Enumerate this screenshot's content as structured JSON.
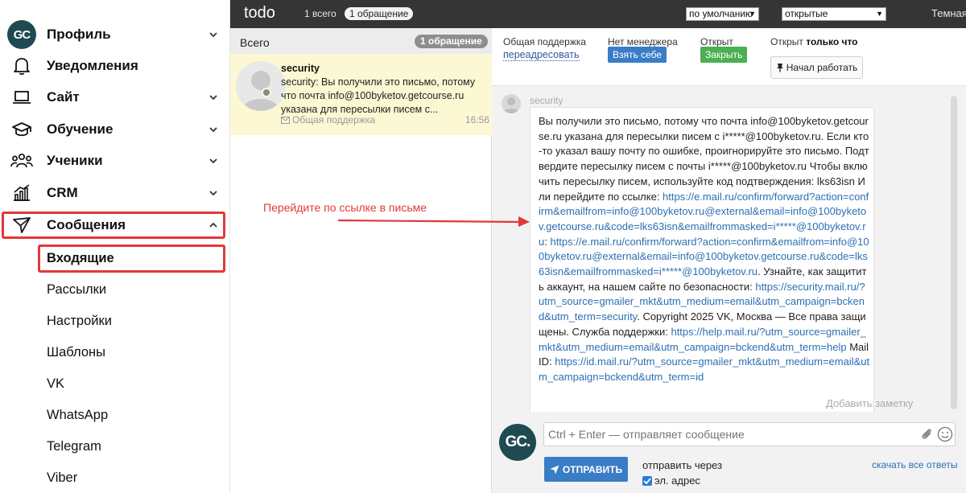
{
  "sidebar": {
    "logo": "GC",
    "items": [
      {
        "label": "Профиль",
        "icon": "gc-logo-icon",
        "chevron": "down"
      },
      {
        "label": "Уведомления",
        "icon": "bell-icon",
        "chevron": null
      },
      {
        "label": "Сайт",
        "icon": "laptop-icon",
        "chevron": "down"
      },
      {
        "label": "Обучение",
        "icon": "graduation-cap-icon",
        "chevron": "down"
      },
      {
        "label": "Ученики",
        "icon": "users-icon",
        "chevron": "down"
      },
      {
        "label": "CRM",
        "icon": "chart-icon",
        "chevron": "down"
      },
      {
        "label": "Сообщения",
        "icon": "send-icon",
        "chevron": "up"
      }
    ],
    "submenu": [
      "Входящие",
      "Рассылки",
      "Настройки",
      "Шаблоны",
      "VK",
      "WhatsApp",
      "Telegram",
      "Viber"
    ]
  },
  "topbar": {
    "title": "todo",
    "count": "1 всего",
    "pill": "1 обращение",
    "sort_select": "по умолчанию",
    "status_select": "открытые",
    "theme": "Темная"
  },
  "list": {
    "header_label": "Всего",
    "header_pill": "1 обращение",
    "ticket": {
      "name": "security",
      "preview": "security: Вы получили это письмо, потому что почта info@100byketov.getcourse.ru указана для пересылки писем с...",
      "source": "Общая поддержка",
      "time": "16:56"
    }
  },
  "conversation": {
    "header": {
      "support_label": "Общая поддержка",
      "reassign_link": "переадресовать",
      "no_manager_label": "Нет менеджера",
      "take_button": "Взять себе",
      "opened_label": "Открыт",
      "close_button": "Закрыть",
      "opened_prefix": "Открыт",
      "opened_when": "только что",
      "start_work_button": "Начал работать"
    },
    "message": {
      "sender": "security",
      "segments": [
        {
          "text": "Вы получили это письмо, потому что почта info@100byketov.getcourse.ru указана для пересылки писем с i*****@100byketov.ru. Если кто-то указал вашу почту по ошибке, проигнорируйте это письмо.  Подтвердите пересылку писем с почты i*****@100byketov.ru Чтобы включить пересылку писем, используйте код подтверждения: lks63isn Или перейдите по ссылке: ",
          "link": false
        },
        {
          "text": "https://e.mail.ru/confirm/forward?action=confirm&emailfrom=info@100byketov.ru@external&email=info@100byketov.getcourse.ru&code=lks63isn&emailfrommasked=i*****@100byketov.ru",
          "link": true
        },
        {
          "text": ": ",
          "link": false
        },
        {
          "text": "https://e.mail.ru/confirm/forward?action=confirm&emailfrom=info@100byketov.ru@external&email=info@100byketov.getcourse.ru&code=lks63isn&emailfrommasked=i*****@100byketov.ru",
          "link": true
        },
        {
          "text": ".  Узнайте, как защитить аккаунт, на нашем сайте по безопасности: ",
          "link": false
        },
        {
          "text": "https://security.mail.ru/?utm_source=gmailer_mkt&utm_medium=email&utm_campaign=bckend&utm_term=security",
          "link": true
        },
        {
          "text": ".  Copyright 2025 VK, Москва — Все права защищены.  Служба поддержки: ",
          "link": false
        },
        {
          "text": "https://help.mail.ru/?utm_source=gmailer_mkt&utm_medium=email&utm_campaign=bckend&utm_term=help",
          "link": true
        },
        {
          "text": "    Mail ID: ",
          "link": false
        },
        {
          "text": "https://id.mail.ru/?utm_source=gmailer_mkt&utm_medium=email&utm_campaign=bckend&utm_term=id",
          "link": true
        }
      ]
    },
    "add_note": "Добавить заметку",
    "composer": {
      "avatar": "GC.",
      "placeholder": "Ctrl + Enter — отправляет сообщение",
      "send_button": "ОТПРАВИТЬ",
      "send_via": "отправить через",
      "email_option": "эл. адрес",
      "download_all": "скачать все ответы"
    }
  },
  "annotation": {
    "text": "Перейдите по ссылке в письме",
    "color": "#e0393a"
  },
  "colors": {
    "topbar_bg": "#353535",
    "ticket_bg": "#fcf8d4",
    "primary_blue": "#3a7dc6",
    "green": "#4caf50",
    "highlight_red": "#e0393a",
    "logo_bg": "#1f4a52"
  }
}
